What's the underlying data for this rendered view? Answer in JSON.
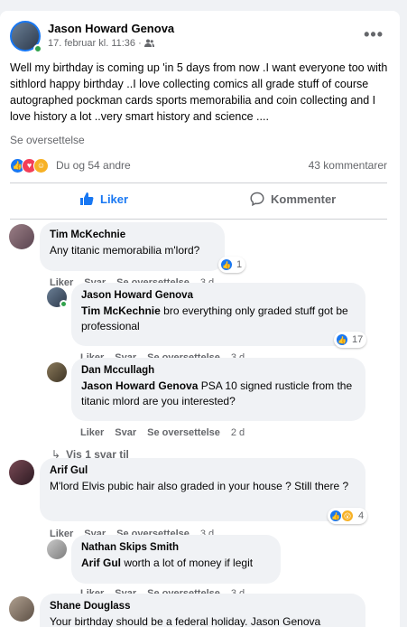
{
  "post": {
    "author": "Jason Howard Genova",
    "date": "17. februar kl. 11:36 ·",
    "text": "Well my birthday is  coming up 'in 5 days from now .I want everyone too with sithlord happy birthday ..I love collecting comics all grade stuff of course autographed pockman cards sports memorabilia and coin collecting and I love history a lot ..very smart history and science ....",
    "translate": "Se oversettelse",
    "reactions_text": "Du og 54 andre",
    "comments_text": "43 kommentarer",
    "more_label": "•••"
  },
  "actions": {
    "like": "Liker",
    "comment": "Kommenter"
  },
  "comments": [
    {
      "name": "Tim McKechnie",
      "text": "Any titanic memorabilia m'lord?",
      "like": "Liker",
      "reply": "Svar",
      "translate": "Se oversettelse",
      "time": "3 d",
      "react_count": "1"
    },
    {
      "name": "Jason Howard Genova",
      "tag": "Tim McKechnie",
      "text": " bro everything only graded stuff got be professional",
      "like": "Liker",
      "reply": "Svar",
      "translate": "Se oversettelse",
      "time": "3 d",
      "react_count": "17"
    },
    {
      "name": "Dan Mccullagh",
      "tag": "Jason Howard Genova",
      "text": " PSA 10 signed rusticle from the titanic mlord are you interested?",
      "like": "Liker",
      "reply": "Svar",
      "translate": "Se oversettelse",
      "time": "2 d"
    },
    {
      "name": "Arif Gul",
      "text": "M'lord Elvis pubic hair also graded in your house ? Still there ?",
      "like": "Liker",
      "reply": "Svar",
      "translate": "Se oversettelse",
      "time": "3 d",
      "react_count": "4"
    },
    {
      "name": "Nathan Skips Smith",
      "tag": "Arif Gul",
      "text": " worth a lot of money if legit",
      "like": "Liker",
      "reply": "Svar",
      "translate": "Se oversettelse",
      "time": "3 d"
    },
    {
      "name": "Shane Douglass",
      "text": "Your birthday should be a federal holiday. Jason Genova"
    }
  ],
  "view_replies": "Vis 1 svar til",
  "colors": {
    "accent": "#1877f2",
    "muted": "#65676b",
    "bubble": "#f0f2f5",
    "online": "#31a24c"
  }
}
